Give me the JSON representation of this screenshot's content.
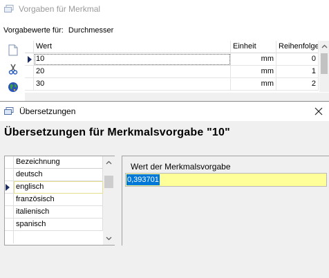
{
  "background_window": {
    "title": "Vorgaben für Merkmal",
    "caption_label": "Vorgabewerte für:",
    "caption_value": "Durchmesser",
    "side_buttons": [
      "new-document-icon",
      "scissors-icon",
      "globe-icon"
    ],
    "table": {
      "columns": [
        "Wert",
        "Einheit",
        "Reihenfolge"
      ],
      "rows": [
        {
          "wert": "10",
          "einheit": "mm",
          "reihenfolge": "0"
        },
        {
          "wert": "20",
          "einheit": "mm",
          "reihenfolge": "1"
        },
        {
          "wert": "30",
          "einheit": "mm",
          "reihenfolge": "2"
        }
      ],
      "current_row": 0
    }
  },
  "dialog": {
    "title": "Übersetzungen",
    "heading": "Übersetzungen für Merkmalsvorgabe \"10\"",
    "list": {
      "header": "Bezeichnung",
      "items": [
        "deutsch",
        "englisch",
        "französisch",
        "italienisch",
        "spanisch"
      ],
      "selected_index": 1
    },
    "value_label": "Wert der Merkmalsvorgabe",
    "value": "0,393701",
    "colors": {
      "input_bg": "#ffff99",
      "selection": "#0078d7"
    }
  }
}
